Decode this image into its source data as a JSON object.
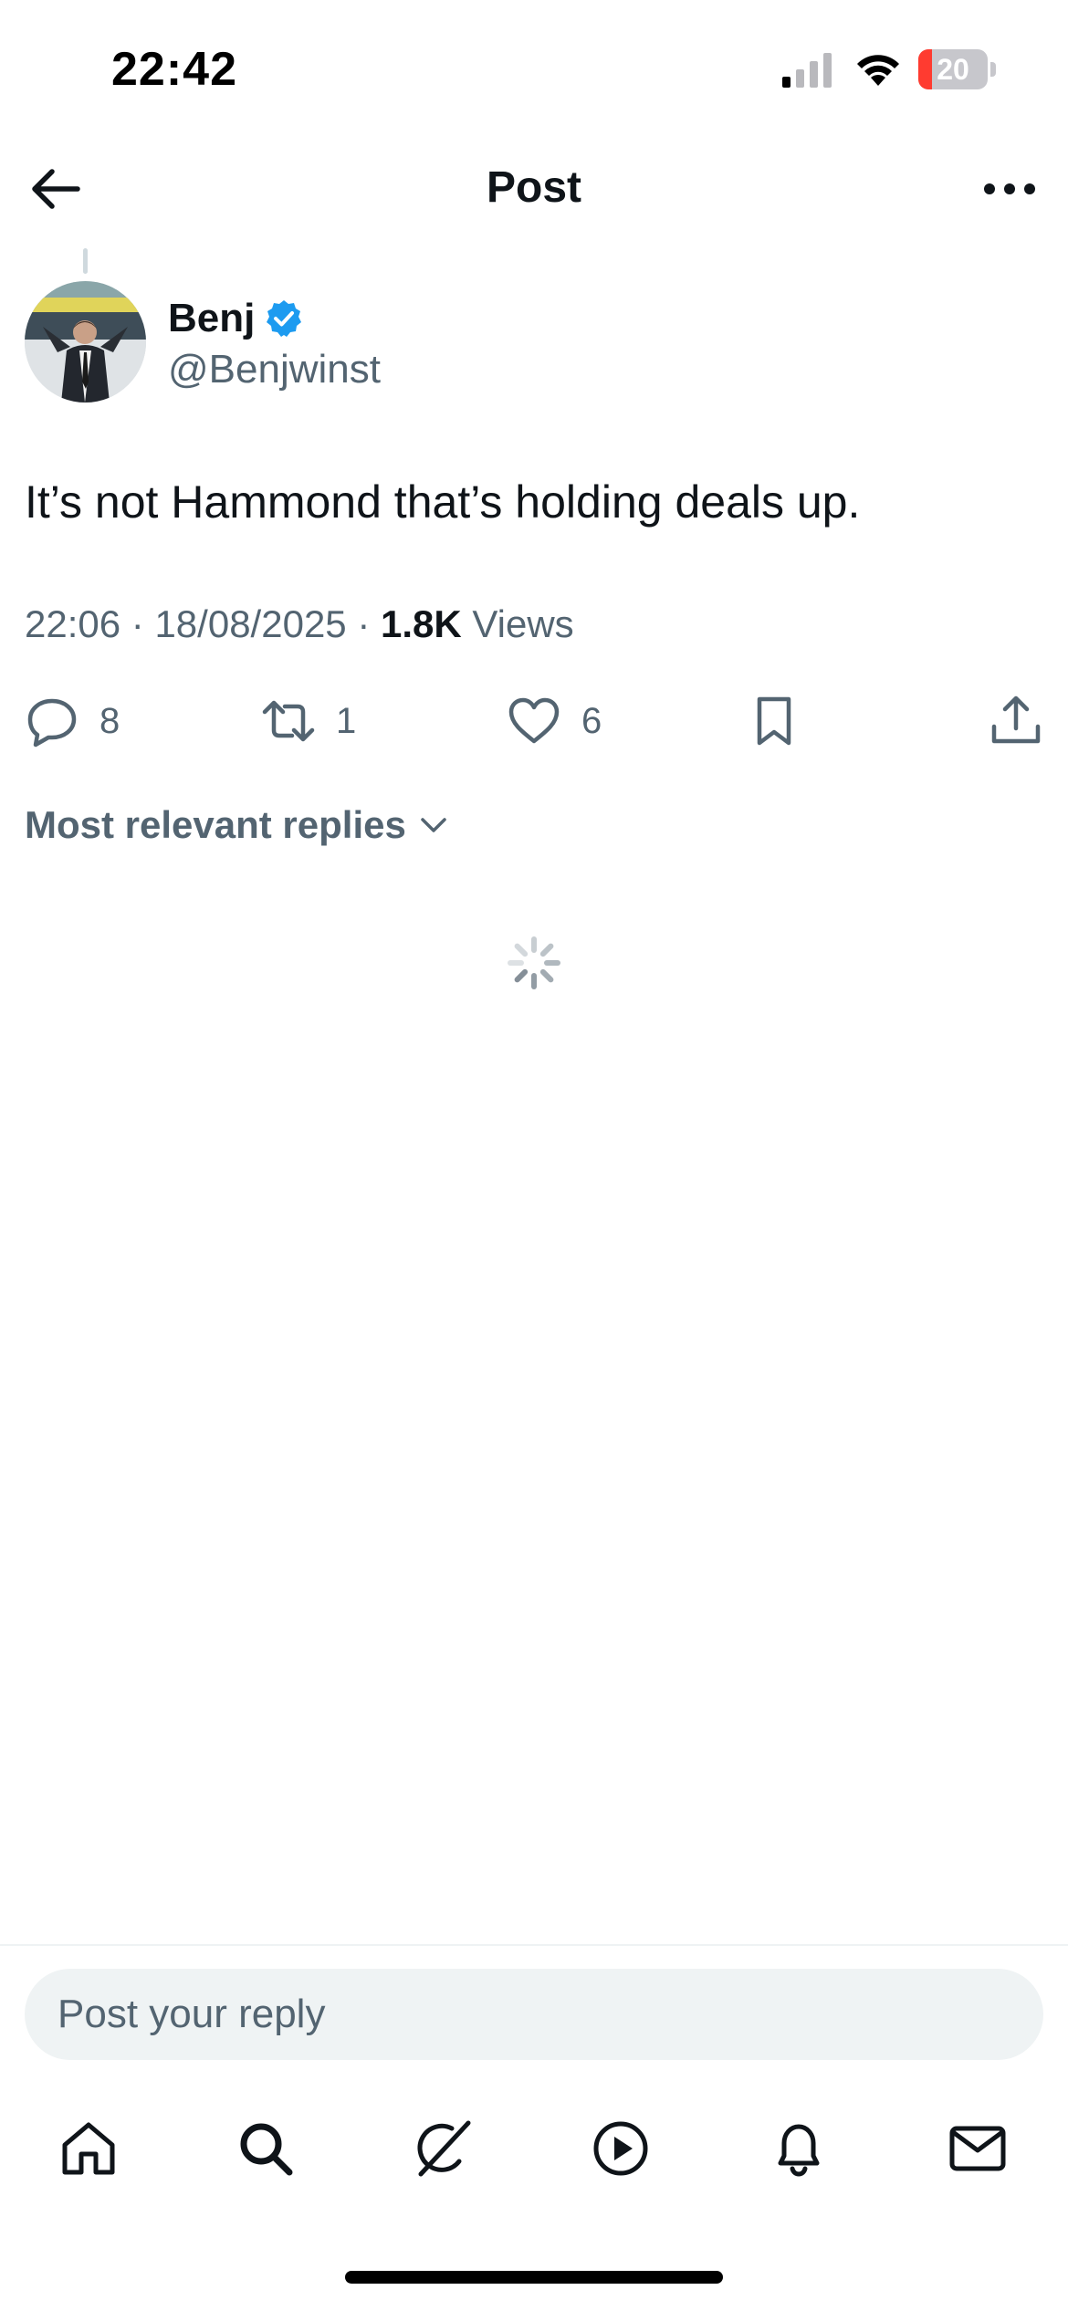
{
  "status_bar": {
    "time": "22:42",
    "battery_level": "20",
    "battery_fraction": 0.2
  },
  "header": {
    "title": "Post",
    "back_icon": "arrow-left-icon",
    "more_icon": "more-horizontal-icon"
  },
  "post": {
    "author_name": "Benj",
    "author_handle": "@Benjwinst",
    "verified": true,
    "text": "It’s not Hammond that’s holding deals up.",
    "time": "22:06",
    "date": "18/08/2025",
    "separator": "·",
    "views_count": "1.8K",
    "views_label": "Views"
  },
  "actions": {
    "replies": "8",
    "reposts": "1",
    "likes": "6"
  },
  "replies_sort": {
    "label": "Most relevant replies"
  },
  "reply_bar": {
    "placeholder": "Post your reply"
  },
  "tabbar": {
    "items": [
      "home-icon",
      "search-icon",
      "grok-icon",
      "video-icon",
      "notifications-icon",
      "messages-icon"
    ]
  },
  "colors": {
    "text_primary": "#0f1419",
    "text_secondary": "#536471",
    "verified_blue": "#1d9bf0",
    "reply_bg": "#eff3f4"
  }
}
